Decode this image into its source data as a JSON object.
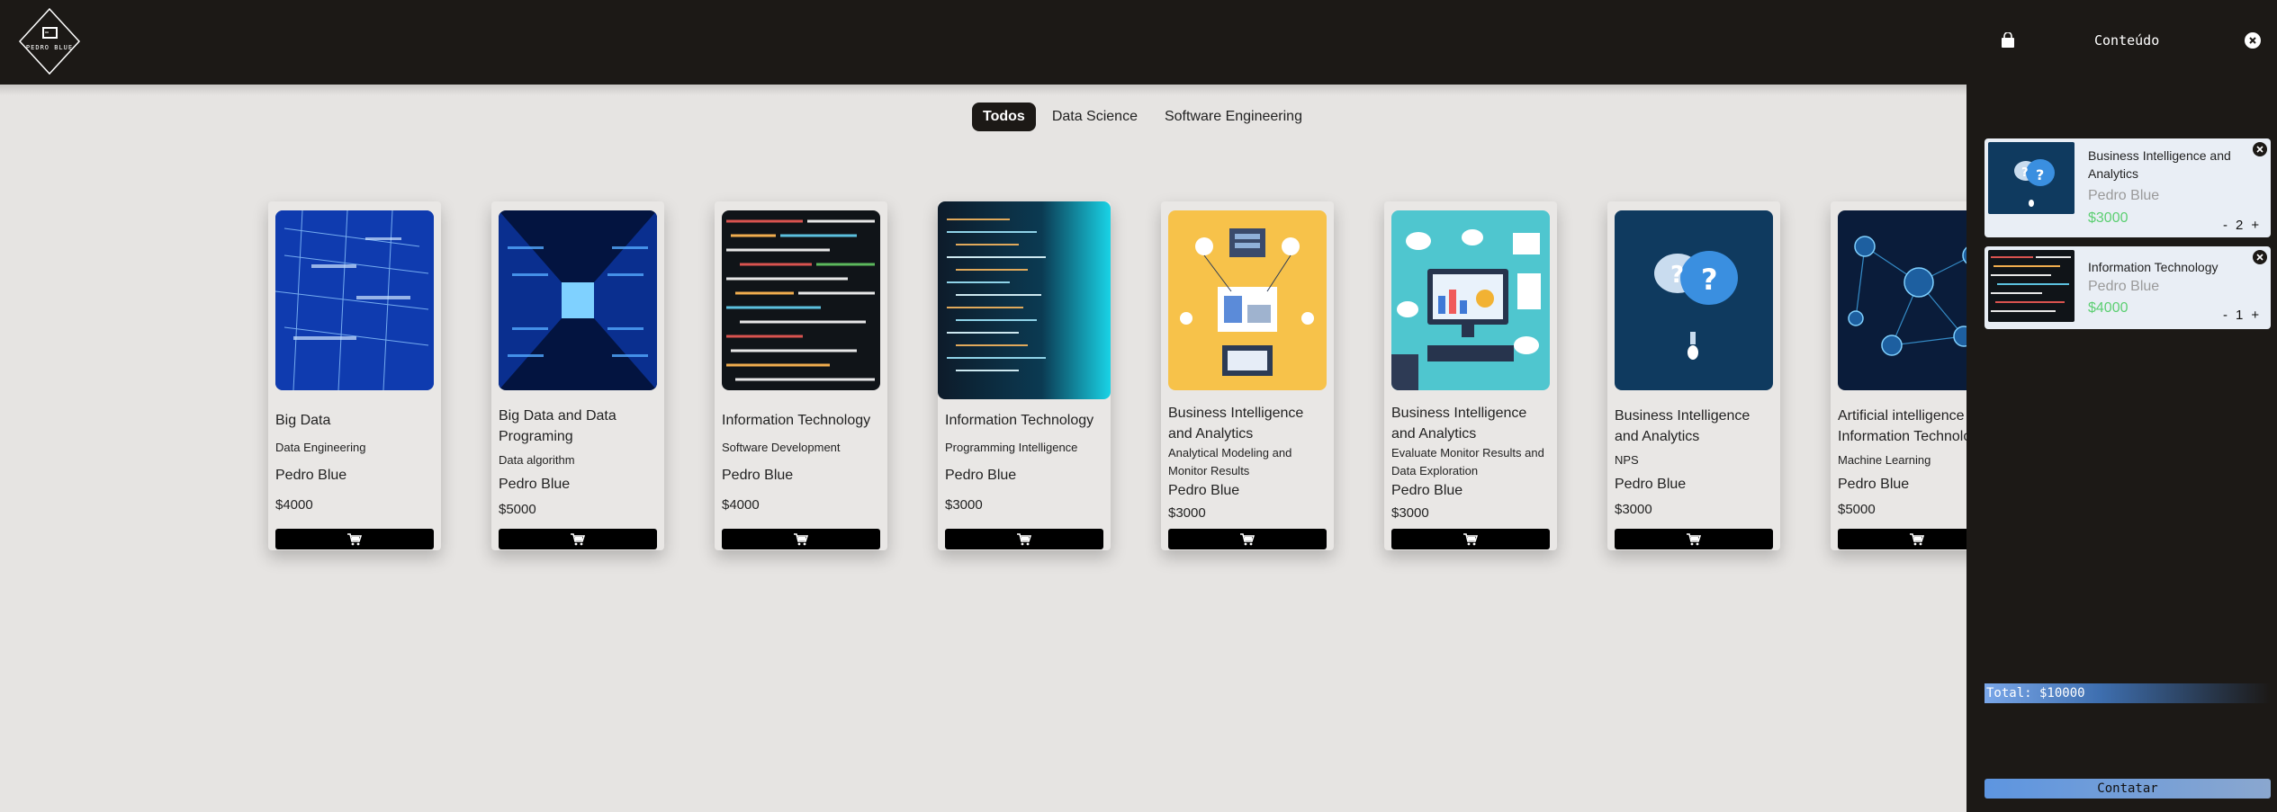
{
  "header": {
    "logo_text": "PEDRO BLUE"
  },
  "filters": [
    {
      "label": "Todos",
      "active": true
    },
    {
      "label": "Data Science",
      "active": false
    },
    {
      "label": "Software Engineering",
      "active": false
    }
  ],
  "products": [
    {
      "title": "Big Data",
      "subtitle": "Data Engineering",
      "author": "Pedro Blue",
      "price": "$4000",
      "image": "blue-data-grid"
    },
    {
      "title": "Big Data and Data Programing",
      "subtitle": "Data algorithm",
      "author": "Pedro Blue",
      "price": "$5000",
      "image": "server-corridor"
    },
    {
      "title": "Information Technology",
      "subtitle": "Software Development",
      "author": "Pedro Blue",
      "price": "$4000",
      "image": "code-screen"
    },
    {
      "title": "Information Technology",
      "subtitle": "Programming Intelligence",
      "author": "Pedro Blue",
      "price": "$3000",
      "image": "code-cyan"
    },
    {
      "title": "Business Intelligence and Analytics",
      "subtitle": "Analytical Modeling and Monitor Results",
      "author": "Pedro Blue",
      "price": "$3000",
      "image": "analytics-yellow"
    },
    {
      "title": "Business Intelligence and Analytics",
      "subtitle": "Evaluate Monitor Results and Data Exploration",
      "author": "Pedro Blue",
      "price": "$3000",
      "image": "analytics-teal"
    },
    {
      "title": "Business Intelligence and Analytics",
      "subtitle": "NPS",
      "author": "Pedro Blue",
      "price": "$3000",
      "image": "question-bubbles"
    },
    {
      "title": "Artificial intelligence Information Technology",
      "subtitle": "Machine Learning",
      "author": "Pedro Blue",
      "price": "$5000",
      "image": "network-nodes"
    }
  ],
  "cart": {
    "title": "Conteúdo",
    "items": [
      {
        "title": "Business Intelligence and Analytics",
        "author": "Pedro Blue",
        "price": "$3000",
        "quantity": "2",
        "minus": "-",
        "plus": "+"
      },
      {
        "title": "Information Technology",
        "author": "Pedro Blue",
        "price": "$4000",
        "quantity": "1",
        "minus": "-",
        "plus": "+"
      }
    ],
    "total": "Total: $10000",
    "contact_label": "Contatar"
  }
}
